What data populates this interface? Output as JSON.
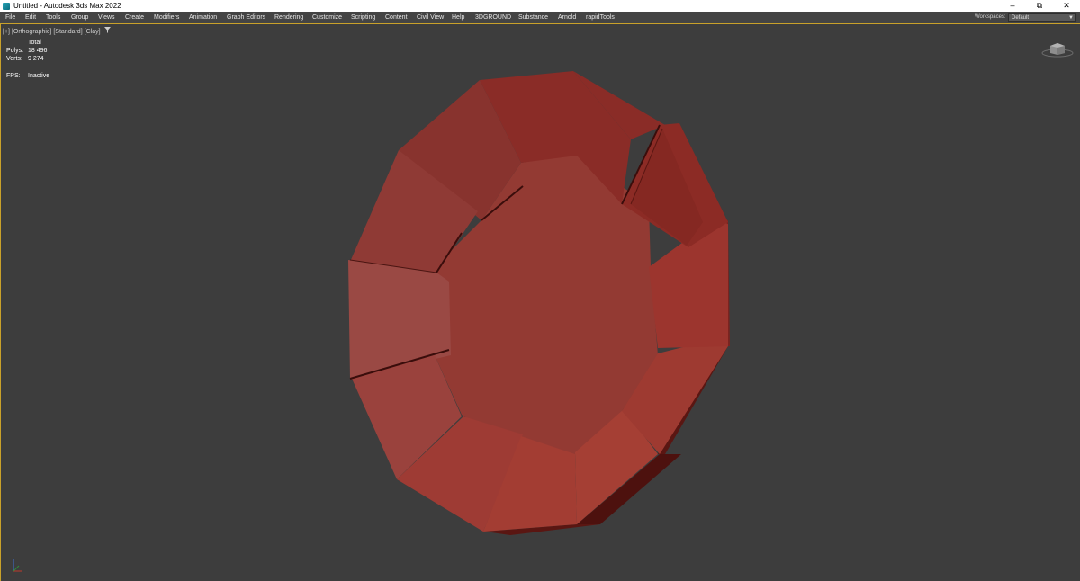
{
  "window": {
    "title": "Untitled - Autodesk 3ds Max 2022",
    "minimize": "–",
    "restore": "⧉",
    "close": "✕"
  },
  "menubar": {
    "items": [
      "File",
      "Edit",
      "Tools",
      "Group",
      "Views",
      "Create",
      "Modifiers",
      "Animation",
      "Graph Editors",
      "Rendering",
      "Customize",
      "Scripting",
      "Content",
      "Civil View",
      "Help",
      "3DGROUND",
      "Substance",
      "Arnold",
      "rapidTools"
    ],
    "workspaces_label": "Workspaces:",
    "workspace_value": "Default"
  },
  "viewport": {
    "label_plus": "[+]",
    "label_view": "[Orthographic]",
    "label_shading_standard": "[Standard]",
    "label_shading_clay": "[Clay]",
    "filter_icon": "filter-icon",
    "stats": {
      "header": "Total",
      "polys_label": "Polys:",
      "polys_value": "18 496",
      "verts_label": "Verts:",
      "verts_value": "9 274",
      "fps_label": "FPS:",
      "fps_value": "Inactive"
    }
  },
  "colors": {
    "viewport_bg": "#3d3d3d",
    "menubar_bg": "#444444",
    "titlebar_bg": "#ffffff",
    "viewport_border": "#c9a12a",
    "object_red": "#a8403a"
  }
}
